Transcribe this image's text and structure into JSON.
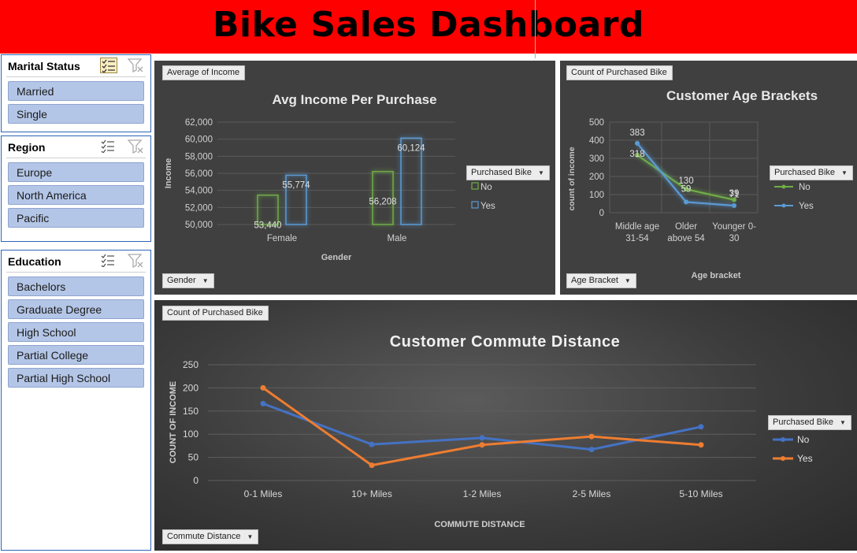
{
  "title": "Bike Sales Dashboard",
  "slicers": {
    "marital": {
      "title": "Marital Status",
      "items": [
        "Married",
        "Single"
      ]
    },
    "region": {
      "title": "Region",
      "items": [
        "Europe",
        "North America",
        "Pacific"
      ]
    },
    "education": {
      "title": "Education",
      "items": [
        "Bachelors",
        "Graduate Degree",
        "High School",
        "Partial College",
        "Partial High School"
      ]
    }
  },
  "colors": {
    "banner": "#ff0000",
    "no_green": "#70ad47",
    "yes_blue": "#5b9bd5",
    "no_line_blue": "#4472c4",
    "yes_orange": "#ed7d31",
    "slicer_item": "#b4c6e7"
  },
  "chart_data": [
    {
      "type": "bar",
      "field_value": "Average of Income",
      "field_axis": "Gender",
      "legend_title": "Purchased Bike",
      "title": "Avg Income Per Purchase",
      "xlabel": "Gender",
      "ylabel": "Income",
      "categories": [
        "Female",
        "Male"
      ],
      "series": [
        {
          "name": "No",
          "values": [
            53440,
            56208
          ],
          "labels": [
            "53,440",
            "56,208"
          ]
        },
        {
          "name": "Yes",
          "values": [
            55774,
            60124
          ],
          "labels": [
            "55,774",
            "60,124"
          ]
        }
      ],
      "ylim": [
        50000,
        62000
      ],
      "yticks": [
        "50,000",
        "52,000",
        "54,000",
        "56,000",
        "58,000",
        "60,000",
        "62,000"
      ],
      "grid": true,
      "legend_position": "right"
    },
    {
      "type": "line",
      "field_value": "Count of Purchased Bike",
      "field_axis": "Age Bracket",
      "legend_title": "Purchased Bike",
      "title": "Customer Age Brackets",
      "xlabel": "Age bracket",
      "ylabel": "count of income",
      "categories": [
        [
          "Middle age",
          "31-54"
        ],
        [
          "Older",
          "above 54"
        ],
        [
          "Younger 0-",
          "30"
        ]
      ],
      "series": [
        {
          "name": "No",
          "values": [
            318,
            130,
            71
          ]
        },
        {
          "name": "Yes",
          "values": [
            383,
            59,
            39
          ]
        }
      ],
      "ylim": [
        0,
        500
      ],
      "yticks": [
        "0",
        "100",
        "200",
        "300",
        "400",
        "500"
      ],
      "grid": true,
      "legend_position": "right"
    },
    {
      "type": "line",
      "field_value": "Count of Purchased Bike",
      "field_axis": "Commute Distance",
      "legend_title": "Purchased Bike",
      "title": "Customer Commute Distance",
      "xlabel": "COMMUTE DISTANCE",
      "ylabel": "COUNT OF INCOME",
      "categories": [
        "0-1 Miles",
        "10+ Miles",
        "1-2 Miles",
        "2-5 Miles",
        "5-10 Miles"
      ],
      "series": [
        {
          "name": "No",
          "values": [
            166,
            78,
            92,
            67,
            116
          ]
        },
        {
          "name": "Yes",
          "values": [
            200,
            33,
            77,
            95,
            77
          ]
        }
      ],
      "ylim": [
        0,
        250
      ],
      "yticks": [
        "0",
        "50",
        "100",
        "150",
        "200",
        "250"
      ],
      "grid": true,
      "legend_position": "right"
    }
  ]
}
